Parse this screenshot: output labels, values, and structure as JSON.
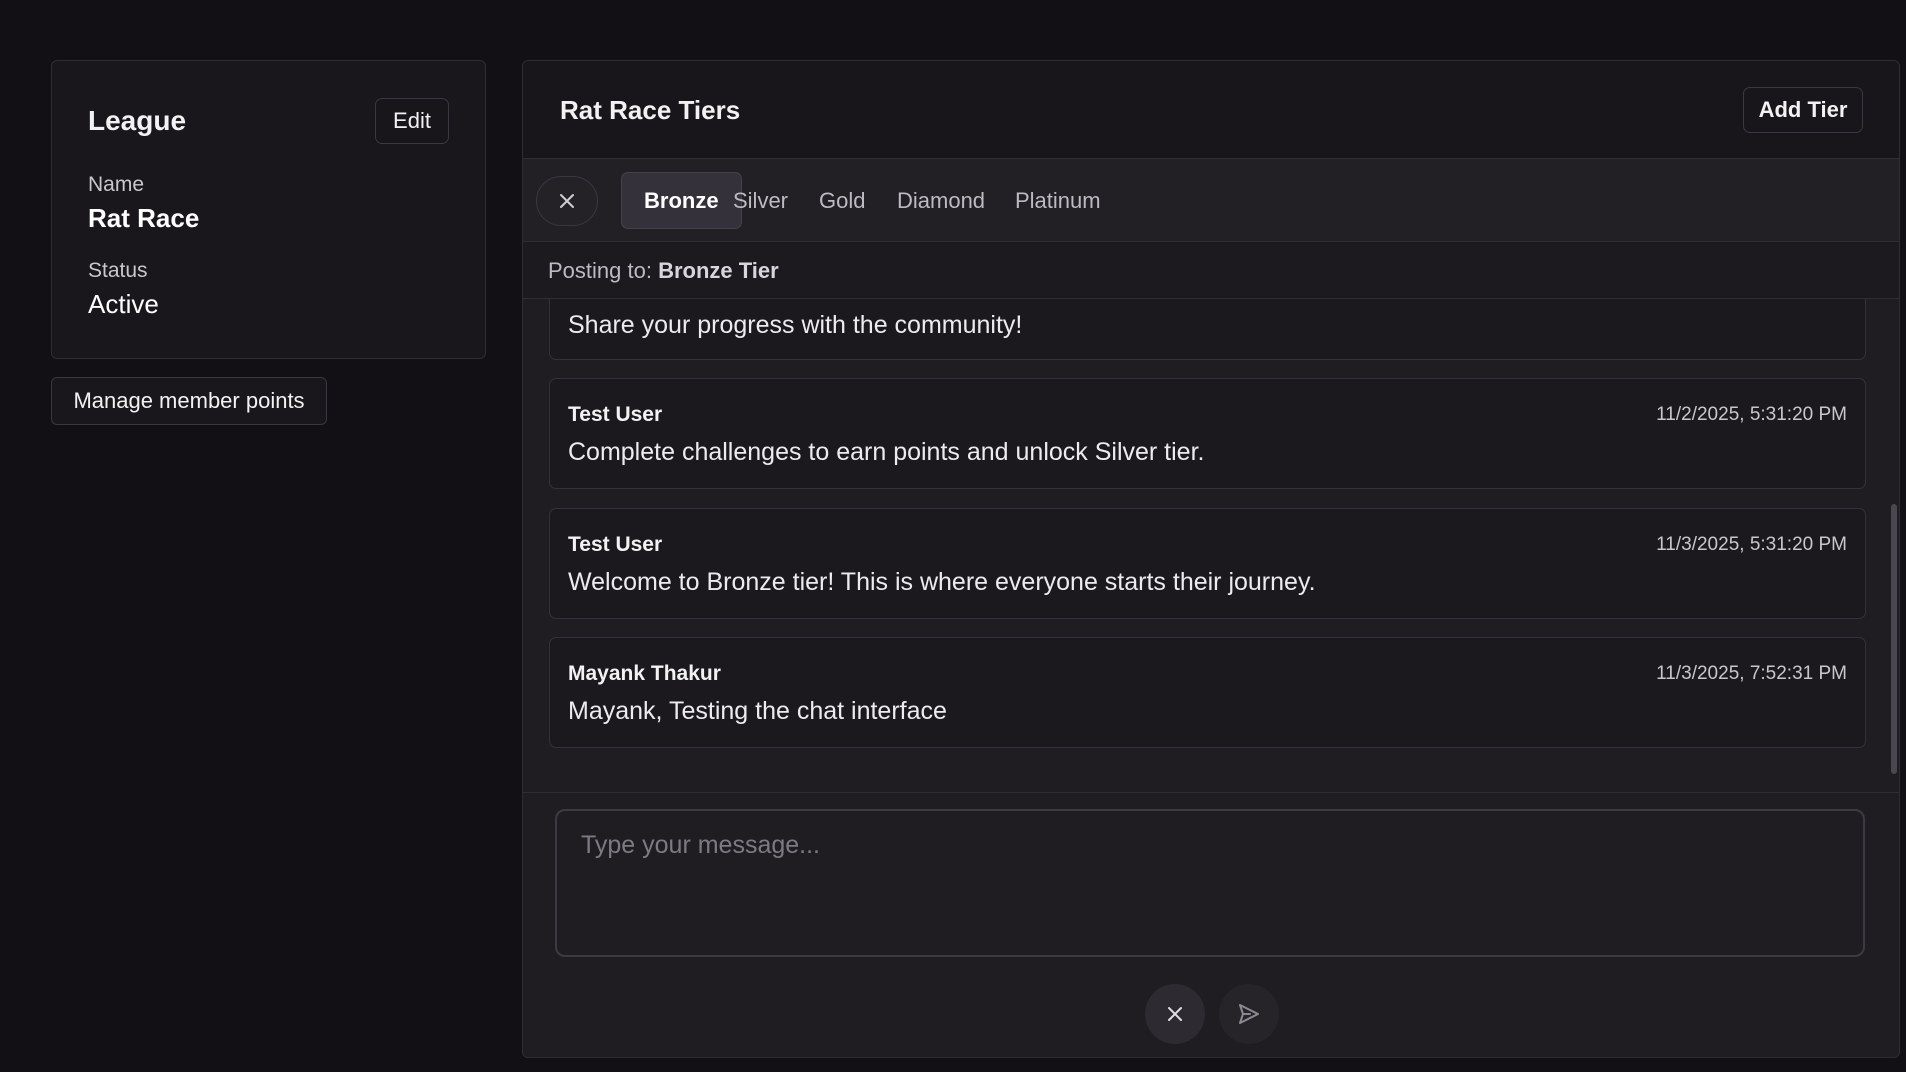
{
  "league": {
    "title": "League",
    "edit_label": "Edit",
    "name_label": "Name",
    "name_value": "Rat Race",
    "status_label": "Status",
    "status_value": "Active"
  },
  "sidebar": {
    "manage_points_label": "Manage member points"
  },
  "tiers_panel": {
    "title": "Rat Race Tiers",
    "add_tier_label": "Add Tier",
    "tabs": [
      {
        "label": "Bronze",
        "active": true
      },
      {
        "label": "Silver",
        "active": false
      },
      {
        "label": "Gold",
        "active": false
      },
      {
        "label": "Diamond",
        "active": false
      },
      {
        "label": "Platinum",
        "active": false
      }
    ],
    "close_icon": "close-icon",
    "posting_prefix": "Posting to:",
    "posting_tier": "Bronze Tier"
  },
  "messages": [
    {
      "author": "",
      "time": "",
      "text": "Share your progress with the community!"
    },
    {
      "author": "Test User",
      "time": "11/2/2025, 5:31:20 PM",
      "text": "Complete challenges to earn points and unlock Silver tier."
    },
    {
      "author": "Test User",
      "time": "11/3/2025, 5:31:20 PM",
      "text": "Welcome to Bronze tier! This is where everyone starts their journey."
    },
    {
      "author": "Mayank Thakur",
      "time": "11/3/2025, 7:52:31 PM",
      "text": "Mayank, Testing the chat interface"
    }
  ],
  "composer": {
    "placeholder": "Type your message...",
    "value": "",
    "clear_icon": "close-icon",
    "send_icon": "send-icon"
  },
  "colors": {
    "page_bg": "#121014",
    "card_bg": "#19171c",
    "panel_bg": "#1f1d22",
    "active_tab_bg": "#34313a",
    "border": "#2f2c33"
  }
}
